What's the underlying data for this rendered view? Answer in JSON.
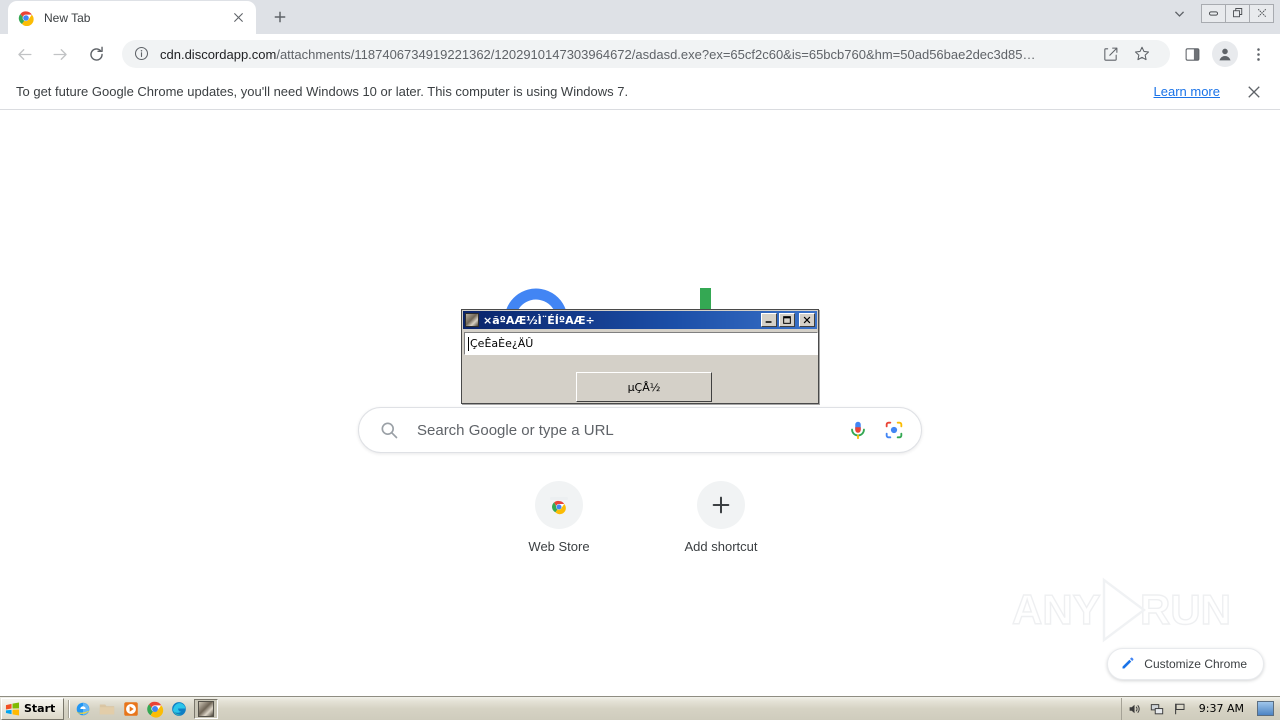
{
  "browser": {
    "tab": {
      "title": "New Tab",
      "favicon": "chrome-icon",
      "close_label": "×"
    },
    "newtab_label": "+",
    "window_controls": {
      "minimize": "–",
      "maximize": "❐",
      "close": "✕",
      "caret": "⌄"
    },
    "nav": {
      "back": "←",
      "forward": "→",
      "reload": "⟳"
    },
    "omnibox": {
      "info_icon": "info-circle-icon",
      "url_host": "cdn.discordapp.com",
      "url_path": "/attachments/1187406734919221362/1202910147303964672/asdasd.exe?ex=65cf2c60&is=65bcb760&hm=50ad56bae2dec3d85…",
      "share_icon": "share-icon",
      "bookmark_icon": "star-icon",
      "sidepanel_icon": "side-panel-icon",
      "profile_icon": "profile-avatar-icon",
      "menu_icon": "three-dot-menu-icon"
    },
    "infobar": {
      "message": "To get future Google Chrome updates, you'll need Windows 10 or later. This computer is using Windows 7.",
      "link": "Learn more",
      "close": "✕"
    }
  },
  "newtab": {
    "logo_alt": "Google",
    "search": {
      "placeholder": "Search Google or type a URL",
      "search_icon": "magnifier-icon",
      "mic_icon": "microphone-icon",
      "lens_icon": "google-lens-icon"
    },
    "shortcuts": [
      {
        "label": "Web Store",
        "icon": "chrome-web-store-icon"
      },
      {
        "label": "Add shortcut",
        "icon": "plus-icon"
      }
    ],
    "customize": {
      "label": "Customize Chrome",
      "icon": "pencil-icon"
    },
    "watermark": "ANY.RUN"
  },
  "dialog": {
    "title": "×ãºAÆ½Ì¨ÉÍºAÆ÷",
    "icon": "app-icon",
    "titlebar_buttons": {
      "minimize": "_",
      "maximize": "□",
      "close": "✕"
    },
    "input_value": "ÇeÊaÈe¿ÄÛ",
    "ok_button": "µÇÅ½"
  },
  "taskbar": {
    "start_label": "Start",
    "quick_launch": [
      {
        "name": "internet-explorer-icon"
      },
      {
        "name": "windows-explorer-icon"
      },
      {
        "name": "media-player-icon"
      },
      {
        "name": "chrome-icon"
      },
      {
        "name": "edge-icon"
      }
    ],
    "tasks": [
      {
        "name": "malware-window-task"
      }
    ],
    "tray": {
      "volume_icon": "speaker-icon",
      "network_icon": "network-icon",
      "flag_icon": "action-center-flag-icon",
      "clock": "9:37 AM",
      "show_desktop": "show-desktop-button"
    }
  }
}
